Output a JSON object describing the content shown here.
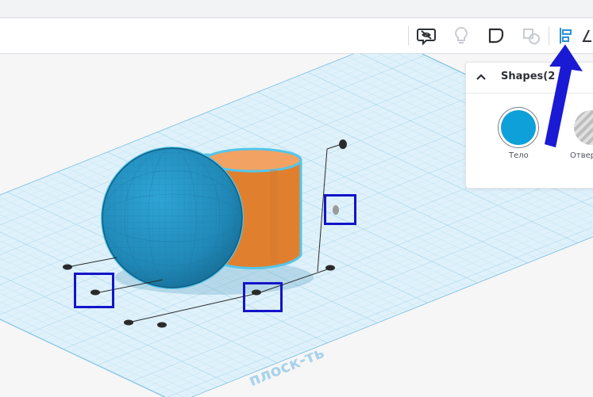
{
  "toolbar": {
    "icons": [
      "eye-hide-icon",
      "lightbulb-icon",
      "group-icon",
      "ungroup-icon",
      "align-icon",
      "mirror-icon"
    ]
  },
  "shapes_panel": {
    "title": "Shapes(2",
    "solid_label": "Тело",
    "hole_label": "Отвер",
    "solid_color": "#0ea0d8",
    "hole_color": "#bdbdbd"
  },
  "workplane": {
    "watermark": "плоск-ть",
    "grid_color": "#a9d8ef"
  },
  "scene": {
    "sphere_color": "#2596c7",
    "cylinder_color": "#e8873b",
    "selection_outline": "#53c6ea"
  },
  "annotations": {
    "box_color": "#1414c8",
    "arrow_color": "#1a1ad4"
  }
}
